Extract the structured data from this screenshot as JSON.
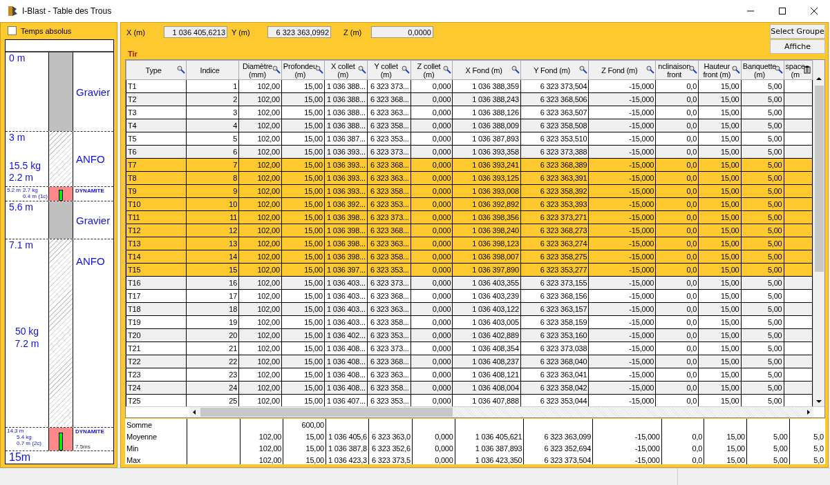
{
  "window": {
    "title": "I-Blast - Table des Trous"
  },
  "log": {
    "checkbox": {
      "label": "Temps absolus",
      "checked": false
    },
    "layers": [
      {
        "kind": "gravel",
        "depth": "0 m",
        "label": "Gravier"
      },
      {
        "kind": "anfo",
        "depth": "3 m",
        "mass": "15.5 kg",
        "length": "2.2 m",
        "label": "ANFO"
      },
      {
        "kind": "primer",
        "depth": "5.2 m",
        "mass": "2.7 kg",
        "length": "0.4 m (1c)",
        "label": "DYNAMITE"
      },
      {
        "kind": "gravel",
        "depth": "5.6 m",
        "label": "Gravier"
      },
      {
        "kind": "anfo",
        "depth": "7.1 m",
        "mass": "50 kg",
        "length": "7.2 m",
        "label": "ANFO"
      },
      {
        "kind": "primer",
        "depth": "14.3 m",
        "mass": "5.4 kg",
        "length": "0.7 m (2c)",
        "label": "DYNAMITE",
        "delay": "7.5ms"
      },
      {
        "kind": "bottom",
        "depth": "15m"
      }
    ]
  },
  "coords": [
    {
      "label": "X (m)",
      "value": "1 036 405,6213"
    },
    {
      "label": "Y (m)",
      "value": "6 323 363,0992"
    },
    {
      "label": "Z (m)",
      "value": "0,0000"
    }
  ],
  "buttons": [
    "Select Groupe",
    "Affiche"
  ],
  "group_label": "Tir",
  "table": {
    "columns": [
      {
        "label": "Type",
        "kind": "filter"
      },
      {
        "label": "Indice",
        "kind": "plain"
      },
      {
        "label": "Diamètre\n(mm)",
        "kind": "filter"
      },
      {
        "label": "Profondeu\n(m)",
        "kind": "filter"
      },
      {
        "label": "X collet\n(m)",
        "kind": "filter"
      },
      {
        "label": "Y collet\n(m)",
        "kind": "filter"
      },
      {
        "label": "Z collet\n(m)",
        "kind": "filter"
      },
      {
        "label": "X Fond (m)",
        "kind": "filter"
      },
      {
        "label": "Y Fond (m)",
        "kind": "filter"
      },
      {
        "label": "Z Fond (m)",
        "kind": "filter"
      },
      {
        "label": "nclinaison\nfront",
        "kind": "filter"
      },
      {
        "label": "Hauteur\nfront (m)",
        "kind": "filter"
      },
      {
        "label": "Banquette\n(m)",
        "kind": "filter"
      },
      {
        "label": "space\n(m",
        "kind": "menu"
      }
    ],
    "rows": [
      {
        "selected": false,
        "cells": [
          "T1",
          "1",
          "102,00",
          "15,00",
          "1 036 388...",
          "6 323 373...",
          "0,000",
          "1 036 388,359",
          "6 323 373,504",
          "-15,000",
          "0,0",
          "15,00",
          "5,00"
        ]
      },
      {
        "selected": false,
        "cells": [
          "T2",
          "2",
          "102,00",
          "15,00",
          "1 036 388...",
          "6 323 368...",
          "0,000",
          "1 036 388,243",
          "6 323 368,506",
          "-15,000",
          "0,0",
          "15,00",
          "5,00"
        ]
      },
      {
        "selected": false,
        "cells": [
          "T3",
          "3",
          "102,00",
          "15,00",
          "1 036 388...",
          "6 323 363...",
          "0,000",
          "1 036 388,126",
          "6 323 363,507",
          "-15,000",
          "0,0",
          "15,00",
          "5,00"
        ]
      },
      {
        "selected": false,
        "cells": [
          "T4",
          "4",
          "102,00",
          "15,00",
          "1 036 388...",
          "6 323 358...",
          "0,000",
          "1 036 388,009",
          "6 323 358,508",
          "-15,000",
          "0,0",
          "15,00",
          "5,00"
        ]
      },
      {
        "selected": false,
        "cells": [
          "T5",
          "5",
          "102,00",
          "15,00",
          "1 036 387...",
          "6 323 353...",
          "0,000",
          "1 036 387,893",
          "6 323 353,510",
          "-15,000",
          "0,0",
          "15,00",
          "5,00"
        ]
      },
      {
        "selected": false,
        "cells": [
          "T6",
          "6",
          "102,00",
          "15,00",
          "1 036 393...",
          "6 323 373...",
          "0,000",
          "1 036 393,358",
          "6 323 373,388",
          "-15,000",
          "0,0",
          "15,00",
          "5,00"
        ]
      },
      {
        "selected": true,
        "cells": [
          "T7",
          "7",
          "102,00",
          "15,00",
          "1 036 393...",
          "6 323 368...",
          "0,000",
          "1 036 393,241",
          "6 323 368,389",
          "-15,000",
          "0,0",
          "15,00",
          "5,00"
        ]
      },
      {
        "selected": true,
        "cells": [
          "T8",
          "8",
          "102,00",
          "15,00",
          "1 036 393...",
          "6 323 363...",
          "0,000",
          "1 036 393,125",
          "6 323 363,391",
          "-15,000",
          "0,0",
          "15,00",
          "5,00"
        ]
      },
      {
        "selected": true,
        "cells": [
          "T9",
          "9",
          "102,00",
          "15,00",
          "1 036 393...",
          "6 323 358...",
          "0,000",
          "1 036 393,008",
          "6 323 358,392",
          "-15,000",
          "0,0",
          "15,00",
          "5,00"
        ]
      },
      {
        "selected": true,
        "cells": [
          "T10",
          "10",
          "102,00",
          "15,00",
          "1 036 392...",
          "6 323 353...",
          "0,000",
          "1 036 392,892",
          "6 323 353,393",
          "-15,000",
          "0,0",
          "15,00",
          "5,00"
        ]
      },
      {
        "selected": true,
        "cells": [
          "T11",
          "11",
          "102,00",
          "15,00",
          "1 036 398...",
          "6 323 373...",
          "0,000",
          "1 036 398,356",
          "6 323 373,271",
          "-15,000",
          "0,0",
          "15,00",
          "5,00"
        ]
      },
      {
        "selected": true,
        "cells": [
          "T12",
          "12",
          "102,00",
          "15,00",
          "1 036 398...",
          "6 323 368...",
          "0,000",
          "1 036 398,240",
          "6 323 368,273",
          "-15,000",
          "0,0",
          "15,00",
          "5,00"
        ]
      },
      {
        "selected": true,
        "cells": [
          "T13",
          "13",
          "102,00",
          "15,00",
          "1 036 398...",
          "6 323 363...",
          "0,000",
          "1 036 398,123",
          "6 323 363,274",
          "-15,000",
          "0,0",
          "15,00",
          "5,00"
        ]
      },
      {
        "selected": true,
        "cells": [
          "T14",
          "14",
          "102,00",
          "15,00",
          "1 036 398...",
          "6 323 358...",
          "0,000",
          "1 036 398,007",
          "6 323 358,275",
          "-15,000",
          "0,0",
          "15,00",
          "5,00"
        ]
      },
      {
        "selected": true,
        "cells": [
          "T15",
          "15",
          "102,00",
          "15,00",
          "1 036 397...",
          "6 323 353...",
          "0,000",
          "1 036 397,890",
          "6 323 353,277",
          "-15,000",
          "0,0",
          "15,00",
          "5,00"
        ]
      },
      {
        "selected": false,
        "cells": [
          "T16",
          "16",
          "102,00",
          "15,00",
          "1 036 403...",
          "6 323 373...",
          "0,000",
          "1 036 403,355",
          "6 323 373,155",
          "-15,000",
          "0,0",
          "15,00",
          "5,00"
        ]
      },
      {
        "selected": false,
        "cells": [
          "T17",
          "17",
          "102,00",
          "15,00",
          "1 036 403...",
          "6 323 368...",
          "0,000",
          "1 036 403,239",
          "6 323 368,156",
          "-15,000",
          "0,0",
          "15,00",
          "5,00"
        ]
      },
      {
        "selected": false,
        "cells": [
          "T18",
          "18",
          "102,00",
          "15,00",
          "1 036 403...",
          "6 323 363...",
          "0,000",
          "1 036 403,122",
          "6 323 363,157",
          "-15,000",
          "0,0",
          "15,00",
          "5,00"
        ]
      },
      {
        "selected": false,
        "cells": [
          "T19",
          "19",
          "102,00",
          "15,00",
          "1 036 403...",
          "6 323 358...",
          "0,000",
          "1 036 403,005",
          "6 323 358,159",
          "-15,000",
          "0,0",
          "15,00",
          "5,00"
        ]
      },
      {
        "selected": false,
        "cells": [
          "T20",
          "20",
          "102,00",
          "15,00",
          "1 036 402...",
          "6 323 353...",
          "0,000",
          "1 036 402,889",
          "6 323 353,160",
          "-15,000",
          "0,0",
          "15,00",
          "5,00"
        ]
      },
      {
        "selected": false,
        "cells": [
          "T21",
          "21",
          "102,00",
          "15,00",
          "1 036 408...",
          "6 323 373...",
          "0,000",
          "1 036 408,354",
          "6 323 373,038",
          "-15,000",
          "0,0",
          "15,00",
          "5,00"
        ]
      },
      {
        "selected": false,
        "cells": [
          "T22",
          "22",
          "102,00",
          "15,00",
          "1 036 408...",
          "6 323 368...",
          "0,000",
          "1 036 408,237",
          "6 323 368,040",
          "-15,000",
          "0,0",
          "15,00",
          "5,00"
        ]
      },
      {
        "selected": false,
        "cells": [
          "T23",
          "23",
          "102,00",
          "15,00",
          "1 036 408...",
          "6 323 363...",
          "0,000",
          "1 036 408,121",
          "6 323 363,041",
          "-15,000",
          "0,0",
          "15,00",
          "5,00"
        ]
      },
      {
        "selected": false,
        "cells": [
          "T24",
          "24",
          "102,00",
          "15,00",
          "1 036 408...",
          "6 323 358...",
          "0,000",
          "1 036 408,004",
          "6 323 358,042",
          "-15,000",
          "0,0",
          "15,00",
          "5,00"
        ]
      },
      {
        "selected": false,
        "cells": [
          "T25",
          "25",
          "102,00",
          "15,00",
          "1 036 407...",
          "6 323 353...",
          "0,000",
          "1 036 407,888",
          "6 323 353,044",
          "-15,000",
          "0,0",
          "15,00",
          "5,00"
        ]
      }
    ],
    "summary": [
      {
        "cells": [
          "Somme",
          null,
          null,
          "600,00"
        ]
      },
      {
        "cells": [
          "Moyenne",
          null,
          "102,00",
          "15,00",
          "1 036 405,6",
          "6 323 363,0",
          "0,000",
          "1 036 405,621",
          "6 323 363,099",
          "-15,000",
          "0,0",
          "15,00",
          "5,00",
          "5,0"
        ]
      },
      {
        "cells": [
          "Min",
          null,
          "102,00",
          "15,00",
          "1 036 387,8",
          "6 323 352,6",
          "0,000",
          "1 036 387,893",
          "6 323 352,694",
          "-15,000",
          "0,0",
          "15,00",
          "5,00",
          "5,0"
        ]
      },
      {
        "cells": [
          "Max",
          null,
          "102,00",
          "15,00",
          "1 036 423,3",
          "6 323 373,5",
          "0,000",
          "1 036 423,350",
          "6 323 373,504",
          "-15,000",
          "0,0",
          "15,00",
          "5,00",
          "5,0"
        ]
      }
    ]
  }
}
